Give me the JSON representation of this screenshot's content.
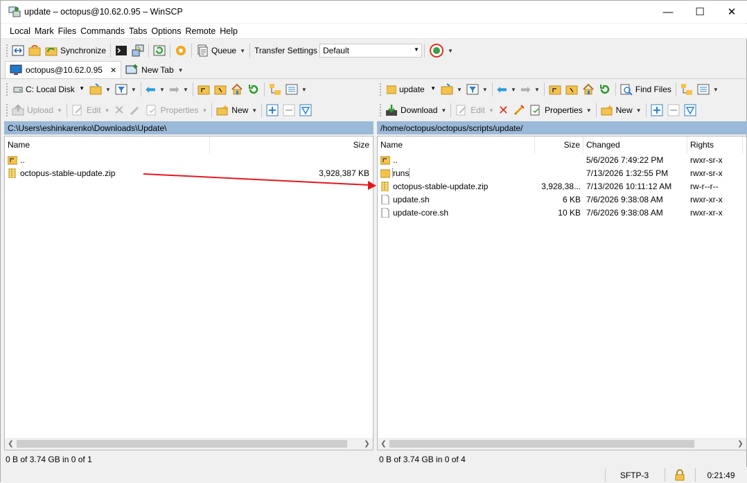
{
  "window": {
    "title": "update – octopus@10.62.0.95 – WinSCP",
    "minimize": "—",
    "maximize": "☐",
    "close": "✕"
  },
  "menu": [
    "Local",
    "Mark",
    "Files",
    "Commands",
    "Tabs",
    "Options",
    "Remote",
    "Help"
  ],
  "toolbar": {
    "synchronize": "Synchronize",
    "queue": "Queue",
    "transfer_settings": "Transfer Settings",
    "transfer_value": "Default"
  },
  "tabs": {
    "session": "octopus@10.62.0.95",
    "close": "✕",
    "new_tab": "New Tab"
  },
  "left": {
    "drive": "C: Local Disk",
    "upload": "Upload",
    "edit": "Edit",
    "properties": "Properties",
    "new": "New",
    "path": "C:\\Users\\eshinkarenko\\Downloads\\Update\\",
    "columns": {
      "name": "Name",
      "size": "Size"
    },
    "files": [
      {
        "name": "..",
        "size": ""
      },
      {
        "name": "octopus-stable-update.zip",
        "size": "3,928,387 KB"
      }
    ],
    "status": "0 B of 3.74 GB in 0 of 1"
  },
  "right": {
    "dir": "update",
    "find_files": "Find Files",
    "download": "Download",
    "edit": "Edit",
    "properties": "Properties",
    "new": "New",
    "path": "/home/octopus/octopus/scripts/update/",
    "columns": {
      "name": "Name",
      "size": "Size",
      "changed": "Changed",
      "rights": "Rights"
    },
    "files": [
      {
        "name": "..",
        "size": "",
        "changed": "5/6/2026 7:49:22 PM",
        "rights": "rwxr-sr-x"
      },
      {
        "name": "runs",
        "size": "",
        "changed": "7/13/2026 1:32:55 PM",
        "rights": "rwxr-sr-x"
      },
      {
        "name": "octopus-stable-update.zip",
        "size": "3,928,38...",
        "changed": "7/13/2026 10:11:12 AM",
        "rights": "rw-r--r--"
      },
      {
        "name": "update.sh",
        "size": "6 KB",
        "changed": "7/6/2026 9:38:08 AM",
        "rights": "rwxr-xr-x"
      },
      {
        "name": "update-core.sh",
        "size": "10 KB",
        "changed": "7/6/2026 9:38:08 AM",
        "rights": "rwxr-xr-x"
      }
    ],
    "status": "0 B of 3.74 GB in 0 of 4"
  },
  "statusbar": {
    "protocol": "SFTP-3",
    "time": "0:21:49"
  },
  "colors": {
    "path_bar": "#9bb9d8",
    "arrow": "#e8161b",
    "folder": "#f5c24c",
    "accent": "#2b7fd4"
  }
}
